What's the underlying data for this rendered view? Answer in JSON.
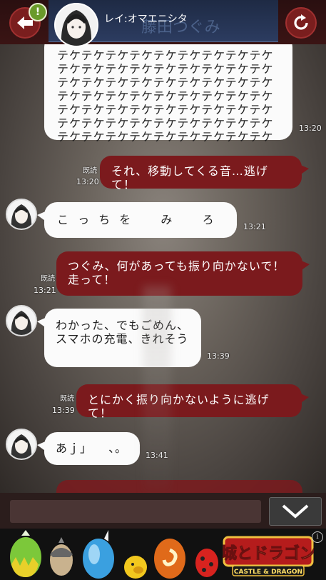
{
  "header": {
    "contact_name": "レイ:オマエニシタ",
    "ghost_name": "藤田つぐみ",
    "badge": "!"
  },
  "messages": [
    {
      "side": "left",
      "text": "テケテケテケテケテケテケテケテケテケテケテケテケテケテケテケテケテケテケテケテケテケテケテケテケテケテケテケテケテケテケテケテケテケテケテケテケテケテケテケテケテケテケテケテケテケテケテケテケテケテケテケテケテケテケテケテケテケテケテケテケテケテケテケ",
      "time": "13:20"
    },
    {
      "side": "right",
      "text": "それ、移動してくる音…逃げて！",
      "time": "13:20",
      "read": "既読"
    },
    {
      "side": "left",
      "text": "こ っ ち を 　 み 　 ろ",
      "time": "13:21"
    },
    {
      "side": "right",
      "text": "つぐみ、何があっても振り向かないで！走って！",
      "time": "13:21",
      "read": "既読"
    },
    {
      "side": "left",
      "text": "わかった、でもごめん、スマホの充電、きれそう",
      "time": "13:39"
    },
    {
      "side": "right",
      "text": "とにかく振り向かないように逃げて！",
      "time": "13:39",
      "read": "既読"
    },
    {
      "side": "left",
      "text": "あｊ」 　、。",
      "time": "13:41"
    }
  ],
  "ad": {
    "logo_line1": "城とドラゴン",
    "logo_line2": "CASTLE & DRAGON",
    "info": "i"
  }
}
